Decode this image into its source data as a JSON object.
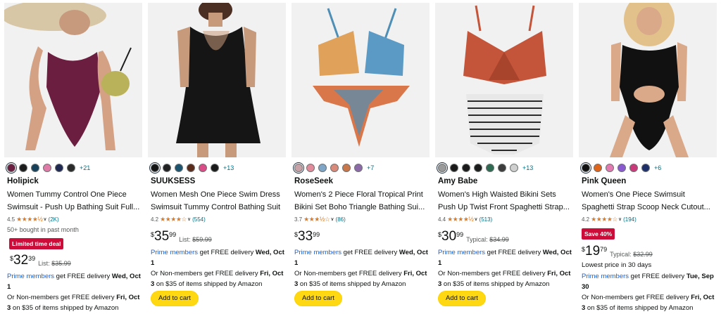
{
  "colors": {
    "accent_link": "#007185",
    "prime_blue": "#1a5fd6",
    "deal_red": "#cc0c39",
    "star": "#de7921",
    "cart_button": "#ffd814"
  },
  "products": [
    {
      "brand": "Holipick",
      "title_line1": "Women Tummy Control One Piece",
      "title_line2": "Swimsuit - Push Up Bathing Suit Full...",
      "rating": "4.5",
      "stars": "★★★★½",
      "reviews": "(2K)",
      "bought": "50+ bought in past month",
      "badge": "Limited time deal",
      "price_currency": "$",
      "price_whole": "32",
      "price_fraction": "39",
      "list_label": "List:",
      "list_price": "$35.99",
      "swatch_colors": [
        "#6b1e3f",
        "#1c1c1c",
        "#17415a",
        "#e07aa7",
        "#1e2850",
        "#2a2a2a"
      ],
      "swatch_more": "+21",
      "delivery_prime_label": "Prime members",
      "delivery_prime_text": " get FREE delivery ",
      "delivery_prime_date": "Wed, Oct 1",
      "delivery_nonmember_text": "Or Non-members get FREE delivery ",
      "delivery_nonmember_date": "Fri, Oct 3",
      "delivery_nonmember_tail": " on $35 of items shipped by Amazon",
      "add_to_cart": ""
    },
    {
      "brand": "SUUKSESS",
      "title_line1": "Women Mesh One Piece Swim Dress",
      "title_line2": "Swimsuit Tummy Control Bathing Suit",
      "rating": "4.2",
      "stars": "★★★★☆",
      "reviews": "(554)",
      "price_currency": "$",
      "price_whole": "35",
      "price_fraction": "99",
      "list_label": "List:",
      "list_price": "$59.99",
      "swatch_colors": [
        "#141414",
        "#222222",
        "#1c5470",
        "#5a2a1a",
        "#d94c86",
        "#1a1a1a"
      ],
      "swatch_more": "+13",
      "delivery_prime_label": "Prime members",
      "delivery_prime_text": " get FREE delivery ",
      "delivery_prime_date": "Wed, Oct 1",
      "delivery_nonmember_text": "Or Non-members get FREE delivery ",
      "delivery_nonmember_date": "Fri, Oct 3",
      "delivery_nonmember_tail": " on $35 of items shipped by Amazon",
      "add_to_cart": "Add to cart"
    },
    {
      "brand": "RoseSeek",
      "title_line1": "Women's 2 Piece Floral Tropical Print",
      "title_line2": "Bikini Set Boho Triangle Bathing Sui...",
      "rating": "3.7",
      "stars": "★★★½☆",
      "reviews": "(86)",
      "price_currency": "$",
      "price_whole": "33",
      "price_fraction": "99",
      "swatch_colors": [
        "#c9a2a8",
        "#e28b9a",
        "#7fa6c7",
        "#d98a7a",
        "#c9764a",
        "#8c6aa8"
      ],
      "swatch_more": "+7",
      "delivery_prime_label": "Prime members",
      "delivery_prime_text": " get FREE delivery ",
      "delivery_prime_date": "Wed, Oct 1",
      "delivery_nonmember_text": "Or Non-members get FREE delivery ",
      "delivery_nonmember_date": "Fri, Oct 3",
      "delivery_nonmember_tail": " on $35 of items shipped by Amazon",
      "add_to_cart": "Add to cart"
    },
    {
      "brand": "Amy Babe",
      "title_line1": "Women's High Waisted Bikini Sets",
      "title_line2": "Push Up Twist Front Spaghetti Strap...",
      "rating": "4.4",
      "stars": "★★★★½",
      "reviews": "(513)",
      "price_currency": "$",
      "price_whole": "30",
      "price_fraction": "99",
      "list_label": "Typical:",
      "list_price": "$34.99",
      "swatch_colors": [
        "#9a9a9a",
        "#1a1a1a",
        "#1a1a1a",
        "#1c1c1c",
        "#2f6a52",
        "#3c3c3c",
        "#cfcfcf"
      ],
      "swatch_more": "+13",
      "delivery_prime_label": "Prime members",
      "delivery_prime_text": " get FREE delivery ",
      "delivery_prime_date": "Wed, Oct 1",
      "delivery_nonmember_text": "Or Non-members get FREE delivery ",
      "delivery_nonmember_date": "Fri, Oct 3",
      "delivery_nonmember_tail": " on $35 of items shipped by Amazon",
      "add_to_cart": "Add to cart"
    },
    {
      "brand": "Pink Queen",
      "title_line1": "Women's One Piece Swimsuit",
      "title_line2": "Spaghetti Strap Scoop Neck Cutout...",
      "rating": "4.2",
      "stars": "★★★★☆",
      "reviews": "(194)",
      "badge": "Save 40%",
      "price_currency": "$",
      "price_whole": "19",
      "price_fraction": "79",
      "list_label": "Typical:",
      "list_price": "$32.99",
      "lowest": "Lowest price in 30 days",
      "swatch_colors": [
        "#111111",
        "#e0641a",
        "#e279b0",
        "#8a5ad0",
        "#c93a7a",
        "#1f2f6a"
      ],
      "swatch_more": "+6",
      "delivery_prime_label": "Prime members",
      "delivery_prime_text": " get FREE delivery ",
      "delivery_prime_date": "Tue, Sep 30",
      "delivery_nonmember_text": "Or Non-members get FREE delivery ",
      "delivery_nonmember_date": "Fri, Oct 3",
      "delivery_nonmember_tail": " on $35 of items shipped by Amazon",
      "add_to_cart": ""
    }
  ]
}
